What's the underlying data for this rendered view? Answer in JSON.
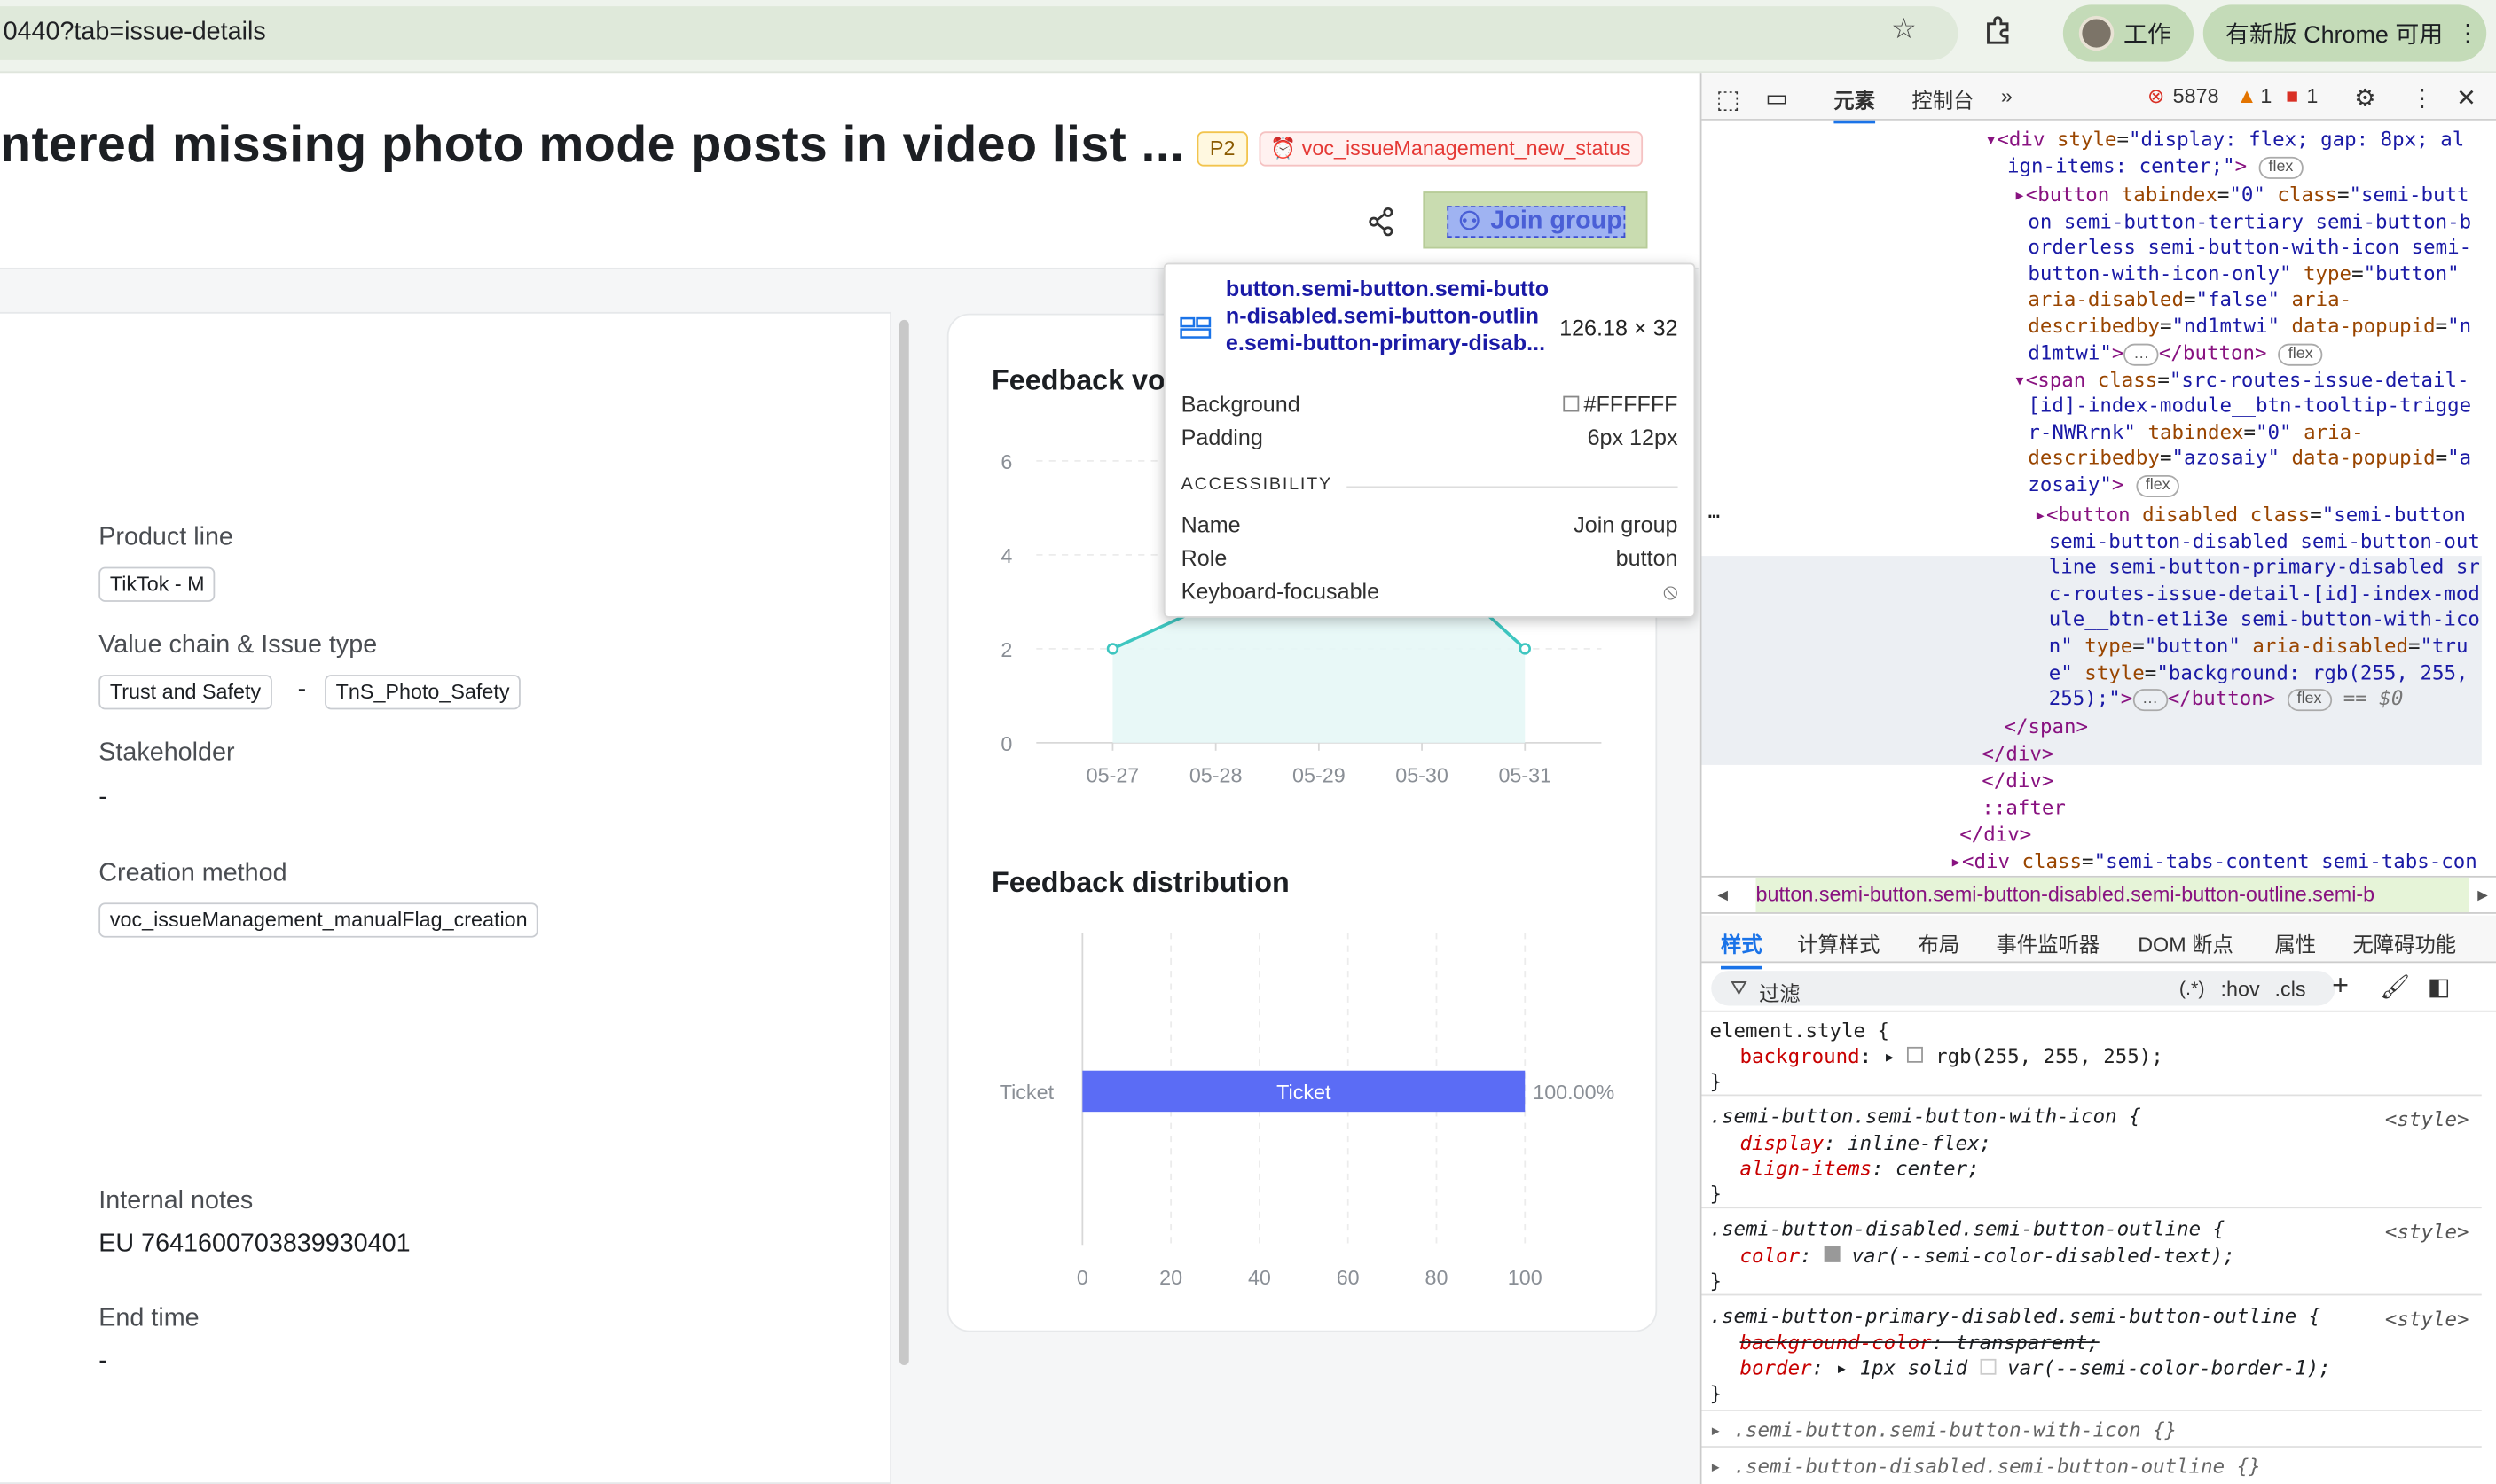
{
  "browser": {
    "url": "0440?tab=issue-details",
    "profile": "工作",
    "update": "有新版 Chrome 可用"
  },
  "issue": {
    "title": "ntered missing photo mode posts in video list ...",
    "priority": "P2",
    "status": "voc_issueManagement_new_status",
    "join_label": "Join group"
  },
  "fields": {
    "product_line_label": "Product line",
    "product_line": "TikTok - M",
    "value_chain_label": "Value chain & Issue type",
    "value_chain": "Trust and Safety",
    "value_sep": "-",
    "issue_type": "TnS_Photo_Safety",
    "stakeholder_label": "Stakeholder",
    "stakeholder": "-",
    "creation_label": "Creation method",
    "creation": "voc_issueManagement_manualFlag_creation",
    "notes_label": "Internal notes",
    "notes": "EU 7641600703839930401",
    "end_label": "End time",
    "end": "-"
  },
  "chart_volume_title": "Feedback vo",
  "chart_dist_title": "Feedback distribution",
  "chart_data": [
    {
      "type": "area",
      "title": "Feedback vo",
      "x": [
        "05-27",
        "05-28",
        "05-29",
        "05-30",
        "05-31"
      ],
      "series": [
        {
          "values": [
            2,
            3,
            4,
            4,
            2
          ]
        }
      ],
      "ylim": [
        0,
        6
      ],
      "yticks": [
        0,
        2,
        4,
        6
      ],
      "color": "#3ec6c0"
    },
    {
      "type": "bar",
      "title": "Feedback distribution",
      "categories": [
        "Ticket"
      ],
      "series": [
        {
          "name": "Ticket",
          "values": [
            100
          ]
        }
      ],
      "data_labels": [
        "100.00%"
      ],
      "xlim": [
        0,
        100
      ],
      "xticks": [
        0,
        20,
        40,
        60,
        80,
        100
      ],
      "color": "#5b6cf5"
    }
  ],
  "tooltip": {
    "selector": "button.semi-button.semi-button-disabled.semi-button-outline.semi-button-primary-disab...",
    "size": "126.18 × 32",
    "rows": [
      {
        "k": "Background",
        "v": "#FFFFFF"
      },
      {
        "k": "Padding",
        "v": "6px 12px"
      }
    ],
    "acc_heading": "ACCESSIBILITY",
    "acc": [
      {
        "k": "Name",
        "v": "Join group"
      },
      {
        "k": "Role",
        "v": "button"
      },
      {
        "k": "Keyboard-focusable",
        "v": ""
      }
    ]
  },
  "devtools": {
    "tabs": [
      "元素",
      "控制台"
    ],
    "errors": "5878",
    "warnings": "1",
    "issues": "1",
    "crumb": "button.semi-button.semi-button-disabled.semi-button-outline.semi-b",
    "subtabs": [
      "样式",
      "计算样式",
      "布局",
      "事件监听器",
      "DOM 断点",
      "属性",
      "无障碍功能"
    ],
    "filter": "过滤",
    "hov": ":hov",
    "cls": ".cls",
    "style_src": "<style>"
  }
}
